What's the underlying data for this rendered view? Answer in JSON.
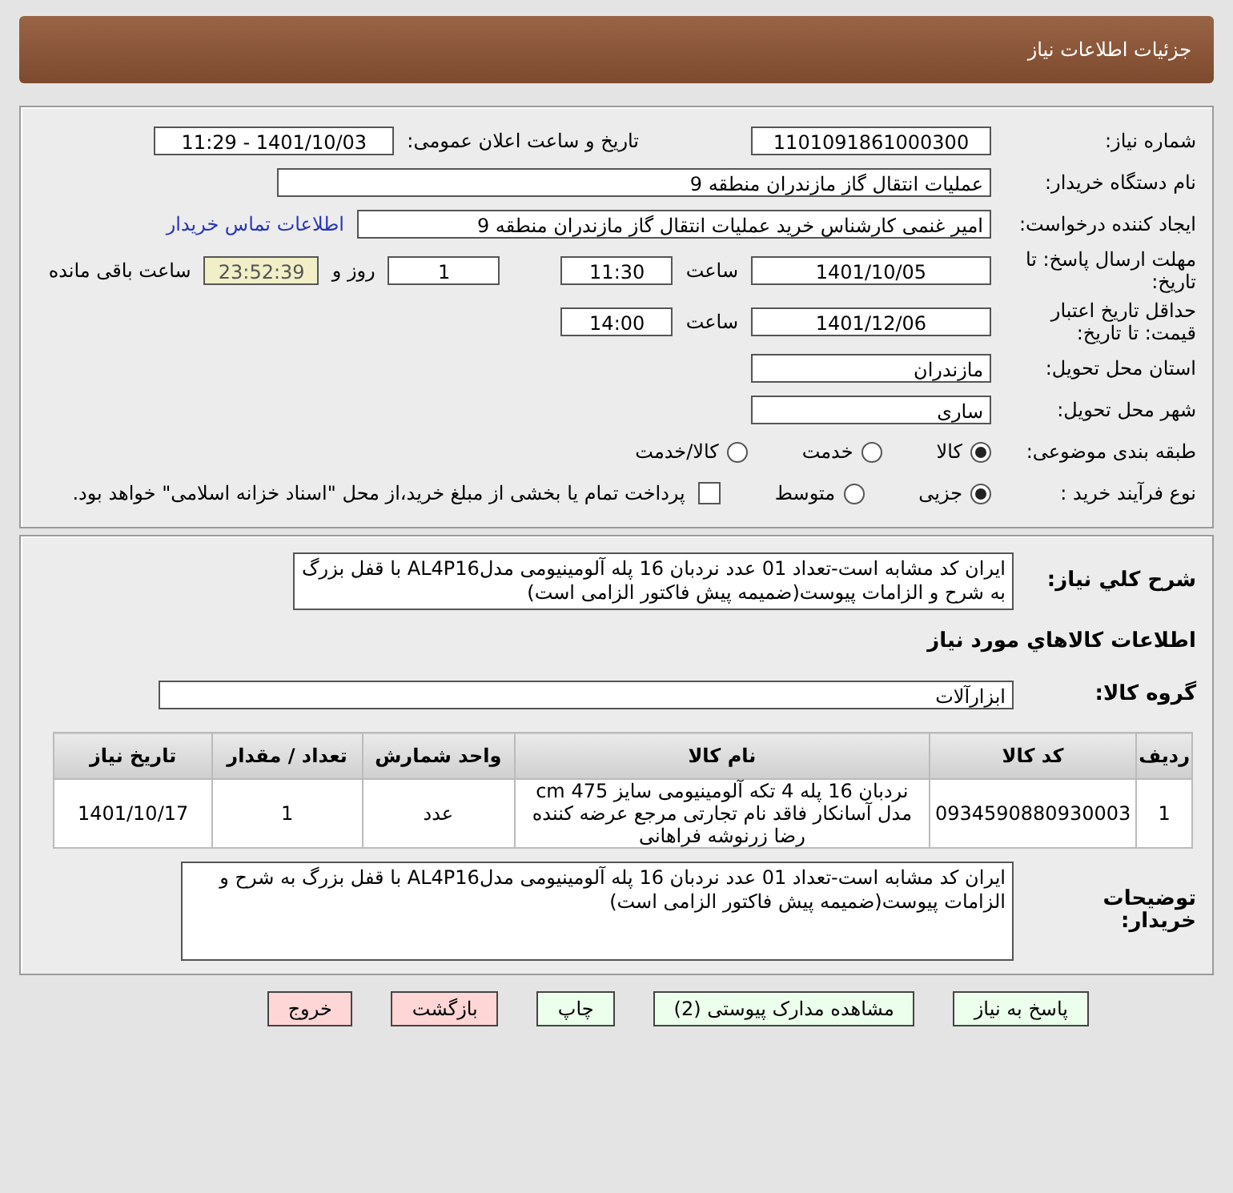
{
  "header": {
    "title": "جزئیات اطلاعات نیاز"
  },
  "need_number": {
    "label": "شماره نیاز:",
    "value": "1101091861000300"
  },
  "announce": {
    "label": "تاریخ و ساعت اعلان عمومی:",
    "value": "1401/10/03 - 11:29"
  },
  "buyer": {
    "label": "نام دستگاه خریدار:",
    "value": "عملیات انتقال گاز مازندران منطقه 9"
  },
  "creator": {
    "label": "ایجاد کننده درخواست:",
    "value": "امیر غنمی کارشناس خرید عملیات انتقال گاز مازندران منطقه 9",
    "link": "اطلاعات تماس خریدار"
  },
  "deadline": {
    "label": "مهلت ارسال پاسخ: تا تاریخ:",
    "date": "1401/10/05",
    "time_label": "ساعت",
    "time": "11:30",
    "days": "1",
    "days_label": "روز و",
    "remaining": "23:52:39",
    "remaining_label": "ساعت باقی مانده"
  },
  "validity": {
    "label": "حداقل تاریخ اعتبار قیمت: تا تاریخ:",
    "date": "1401/12/06",
    "time_label": "ساعت",
    "time": "14:00"
  },
  "province": {
    "label": "استان محل تحویل:",
    "value": "مازندران"
  },
  "city": {
    "label": "شهر محل تحویل:",
    "value": "ساری"
  },
  "category": {
    "label": "طبقه بندی موضوعی:",
    "options": [
      {
        "label": "کالا",
        "selected": true
      },
      {
        "label": "خدمت",
        "selected": false
      },
      {
        "label": "کالا/خدمت",
        "selected": false
      }
    ]
  },
  "process": {
    "label": "نوع فرآیند خرید :",
    "options": [
      {
        "label": "جزیی",
        "selected": true
      },
      {
        "label": "متوسط",
        "selected": false
      }
    ],
    "payment": {
      "label": "پرداخت تمام یا بخشی از مبلغ خرید،از محل \"اسناد خزانه اسلامی\" خواهد بود.",
      "checked": false
    }
  },
  "summary": {
    "label": "شرح کلي نياز:",
    "value": "ایران کد مشابه است-تعداد 01 عدد نردبان 16 پله آلومینیومی مدلAL4P16 با قفل بزرگ به شرح و الزامات پیوست(ضمیمه پیش فاکتور الزامی است)"
  },
  "goods_heading": "اطلاعات کالاهاي مورد نياز",
  "goods_group": {
    "label": "گروه کالا:",
    "value": "ابزارآلات"
  },
  "table": {
    "columns": [
      "ردیف",
      "کد کالا",
      "نام کالا",
      "واحد شمارش",
      "تعداد / مقدار",
      "تاریخ نیاز"
    ],
    "rows": [
      [
        "1",
        "0934590880930003",
        "نردبان 16 پله 4 تکه آلومینیومی سایز 475 cm مدل آسانکار فاقد نام تجارتی مرجع عرضه کننده رضا زرنوشه فراهانی",
        "عدد",
        "1",
        "1401/10/17"
      ]
    ]
  },
  "buyer_notes": {
    "label": "توضیحات خریدار:",
    "value": "ایران کد مشابه است-تعداد 01 عدد نردبان 16 پله آلومینیومی مدلAL4P16 با قفل بزرگ به شرح و الزامات پیوست(ضمیمه پیش فاکتور الزامی است)"
  },
  "buttons": [
    {
      "label": "پاسخ به نیاز",
      "kind": "action"
    },
    {
      "label": "مشاهده مدارک پیوستی (2)",
      "kind": "action"
    },
    {
      "label": "چاپ",
      "kind": "action"
    },
    {
      "label": "بازگشت",
      "kind": "exit"
    },
    {
      "label": "خروج",
      "kind": "exit"
    }
  ]
}
